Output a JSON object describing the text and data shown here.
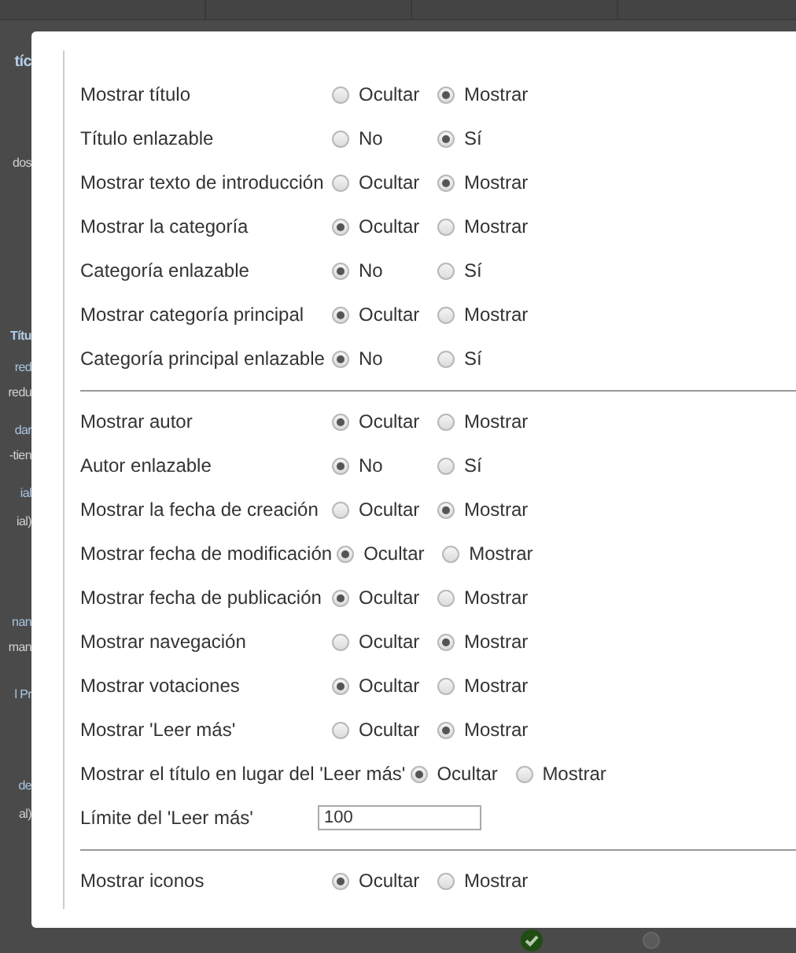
{
  "background_page": {
    "fragments": [
      {
        "text": "tíc",
        "kind": "heading"
      },
      {
        "text": "dos",
        "kind": "tab"
      },
      {
        "text": "Títu",
        "kind": "column"
      },
      {
        "text": "red",
        "kind": "link"
      },
      {
        "text": "redu",
        "kind": "note"
      },
      {
        "text": "dar",
        "kind": "link"
      },
      {
        "text": "-tien",
        "kind": "note"
      },
      {
        "text": "ial",
        "kind": "link"
      },
      {
        "text": "ial)",
        "kind": "note"
      },
      {
        "text": "nan",
        "kind": "link"
      },
      {
        "text": "man",
        "kind": "note"
      },
      {
        "text": "l Pr",
        "kind": "link"
      },
      {
        "text": "de",
        "kind": "link"
      },
      {
        "text": "al)",
        "kind": "note"
      }
    ],
    "status_icons": [
      {
        "kind": "check"
      },
      {
        "kind": "dot"
      }
    ]
  },
  "dialog": {
    "groups": [
      {
        "rows": [
          {
            "kind": "radio",
            "label": "Mostrar título",
            "options": [
              {
                "label": "Ocultar",
                "selected": false
              },
              {
                "label": "Mostrar",
                "selected": true
              }
            ]
          },
          {
            "kind": "radio",
            "label": "Título enlazable",
            "options": [
              {
                "label": "No",
                "selected": false
              },
              {
                "label": "Sí",
                "selected": true
              }
            ]
          },
          {
            "kind": "radio",
            "label": "Mostrar texto de introducción",
            "options": [
              {
                "label": "Ocultar",
                "selected": false
              },
              {
                "label": "Mostrar",
                "selected": true
              }
            ]
          },
          {
            "kind": "radio",
            "label": "Mostrar la categoría",
            "options": [
              {
                "label": "Ocultar",
                "selected": true
              },
              {
                "label": "Mostrar",
                "selected": false
              }
            ]
          },
          {
            "kind": "radio",
            "label": "Categoría enlazable",
            "options": [
              {
                "label": "No",
                "selected": true
              },
              {
                "label": "Sí",
                "selected": false
              }
            ]
          },
          {
            "kind": "radio",
            "label": "Mostrar categoría principal",
            "options": [
              {
                "label": "Ocultar",
                "selected": true
              },
              {
                "label": "Mostrar",
                "selected": false
              }
            ]
          },
          {
            "kind": "radio",
            "label": "Categoría principal enlazable",
            "options": [
              {
                "label": "No",
                "selected": true
              },
              {
                "label": "Sí",
                "selected": false
              }
            ]
          }
        ]
      },
      {
        "rows": [
          {
            "kind": "radio",
            "label": "Mostrar autor",
            "options": [
              {
                "label": "Ocultar",
                "selected": true
              },
              {
                "label": "Mostrar",
                "selected": false
              }
            ]
          },
          {
            "kind": "radio",
            "label": "Autor enlazable",
            "options": [
              {
                "label": "No",
                "selected": true
              },
              {
                "label": "Sí",
                "selected": false
              }
            ]
          },
          {
            "kind": "radio",
            "label": "Mostrar la fecha de creación",
            "options": [
              {
                "label": "Ocultar",
                "selected": false
              },
              {
                "label": "Mostrar",
                "selected": true
              }
            ]
          },
          {
            "kind": "radio",
            "label": "Mostrar fecha de modificación",
            "options": [
              {
                "label": "Ocultar",
                "selected": true
              },
              {
                "label": "Mostrar",
                "selected": false
              }
            ]
          },
          {
            "kind": "radio",
            "label": "Mostrar fecha de publicación",
            "options": [
              {
                "label": "Ocultar",
                "selected": true
              },
              {
                "label": "Mostrar",
                "selected": false
              }
            ]
          },
          {
            "kind": "radio",
            "label": "Mostrar navegación",
            "options": [
              {
                "label": "Ocultar",
                "selected": false
              },
              {
                "label": "Mostrar",
                "selected": true
              }
            ]
          },
          {
            "kind": "radio",
            "label": "Mostrar votaciones",
            "options": [
              {
                "label": "Ocultar",
                "selected": true
              },
              {
                "label": "Mostrar",
                "selected": false
              }
            ]
          },
          {
            "kind": "radio",
            "label": "Mostrar 'Leer más'",
            "options": [
              {
                "label": "Ocultar",
                "selected": false
              },
              {
                "label": "Mostrar",
                "selected": true
              }
            ]
          },
          {
            "kind": "radio",
            "label": "Mostrar el título en lugar del 'Leer más'",
            "options": [
              {
                "label": "Ocultar",
                "selected": true
              },
              {
                "label": "Mostrar",
                "selected": false
              }
            ]
          },
          {
            "kind": "text",
            "label": "Límite del 'Leer más'",
            "value": "100"
          }
        ]
      },
      {
        "rows": [
          {
            "kind": "radio",
            "label": "Mostrar iconos",
            "options": [
              {
                "label": "Ocultar",
                "selected": true
              },
              {
                "label": "Mostrar",
                "selected": false
              }
            ]
          }
        ]
      }
    ]
  }
}
